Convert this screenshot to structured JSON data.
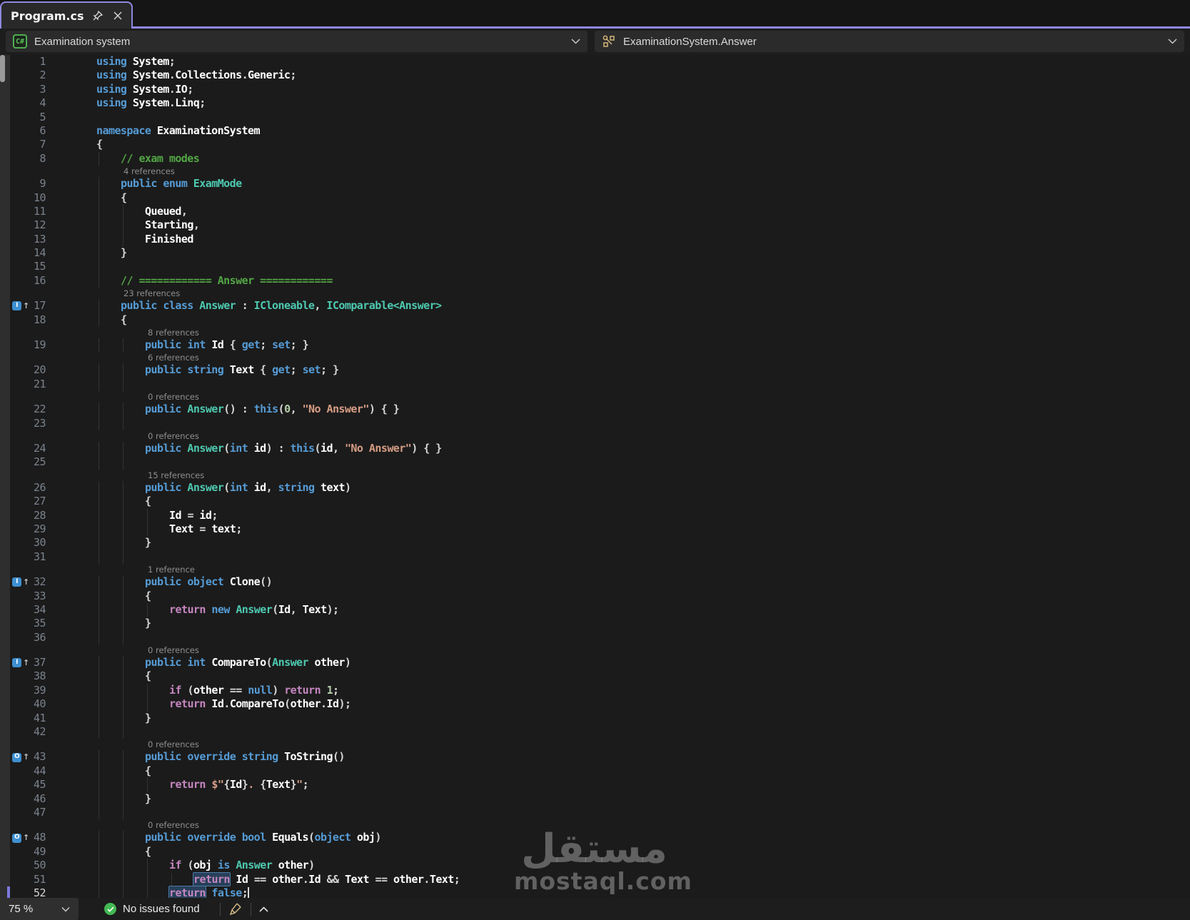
{
  "tab": {
    "title": "Program.cs"
  },
  "breadcrumb": {
    "project": "Examination system",
    "project_badge": "C#",
    "symbol": "ExaminationSystem.Answer"
  },
  "status": {
    "zoom": "75 %",
    "message": "No issues found"
  },
  "watermark": {
    "arabic": "مستقل",
    "domain": "mostaql.com"
  },
  "colors": {
    "accent_purple": "#8d88e0",
    "keyword": "#569cd6",
    "control_keyword": "#c586c0",
    "type": "#4ec9b0",
    "string": "#d69d85",
    "number": "#b5cea8",
    "comment": "#53a645",
    "ok_green": "#43b954",
    "badge_blue": "#3e8fd0"
  },
  "editor": {
    "rows": [
      {
        "t": "c",
        "n": 1,
        "i": 0,
        "k": [
          [
            "k",
            "using "
          ],
          [
            "i",
            "System"
          ],
          [
            "p",
            ";"
          ]
        ]
      },
      {
        "t": "c",
        "n": 2,
        "i": 0,
        "k": [
          [
            "k",
            "using "
          ],
          [
            "i",
            "System"
          ],
          [
            "p",
            "."
          ],
          [
            "i",
            "Collections"
          ],
          [
            "p",
            "."
          ],
          [
            "i",
            "Generic"
          ],
          [
            "p",
            ";"
          ]
        ]
      },
      {
        "t": "c",
        "n": 3,
        "i": 0,
        "k": [
          [
            "k",
            "using "
          ],
          [
            "i",
            "System"
          ],
          [
            "p",
            "."
          ],
          [
            "i",
            "IO"
          ],
          [
            "p",
            ";"
          ]
        ]
      },
      {
        "t": "c",
        "n": 4,
        "i": 0,
        "k": [
          [
            "k",
            "using "
          ],
          [
            "i",
            "System"
          ],
          [
            "p",
            "."
          ],
          [
            "i",
            "Linq"
          ],
          [
            "p",
            ";"
          ]
        ]
      },
      {
        "t": "c",
        "n": 5,
        "i": 0,
        "k": []
      },
      {
        "t": "c",
        "n": 6,
        "i": 0,
        "k": [
          [
            "k",
            "namespace "
          ],
          [
            "i",
            "ExaminationSystem"
          ]
        ]
      },
      {
        "t": "c",
        "n": 7,
        "i": 0,
        "k": [
          [
            "p",
            "{"
          ]
        ]
      },
      {
        "t": "c",
        "n": 8,
        "i": 1,
        "k": [
          [
            "m",
            "// exam modes"
          ]
        ]
      },
      {
        "t": "l",
        "i": 1,
        "s": "4 references"
      },
      {
        "t": "c",
        "n": 9,
        "i": 1,
        "k": [
          [
            "k",
            "public "
          ],
          [
            "k",
            "enum "
          ],
          [
            "t",
            "ExamMode"
          ]
        ]
      },
      {
        "t": "c",
        "n": 10,
        "i": 1,
        "k": [
          [
            "p",
            "{"
          ]
        ]
      },
      {
        "t": "c",
        "n": 11,
        "i": 2,
        "k": [
          [
            "i",
            "Queued"
          ],
          [
            "p",
            ","
          ]
        ]
      },
      {
        "t": "c",
        "n": 12,
        "i": 2,
        "k": [
          [
            "i",
            "Starting"
          ],
          [
            "p",
            ","
          ]
        ]
      },
      {
        "t": "c",
        "n": 13,
        "i": 2,
        "k": [
          [
            "i",
            "Finished"
          ]
        ]
      },
      {
        "t": "c",
        "n": 14,
        "i": 1,
        "k": [
          [
            "p",
            "}"
          ]
        ]
      },
      {
        "t": "c",
        "n": 15,
        "i": 1,
        "k": []
      },
      {
        "t": "c",
        "n": 16,
        "i": 1,
        "k": [
          [
            "m",
            "// ============ Answer ============"
          ]
        ]
      },
      {
        "t": "l",
        "i": 1,
        "s": "23 references"
      },
      {
        "t": "c",
        "n": 17,
        "i": 1,
        "g": "box",
        "k": [
          [
            "k",
            "public "
          ],
          [
            "k",
            "class "
          ],
          [
            "t",
            "Answer"
          ],
          [
            "p",
            " : "
          ],
          [
            "t",
            "ICloneable"
          ],
          [
            "p",
            ", "
          ],
          [
            "t",
            "IComparable<Answer>"
          ]
        ]
      },
      {
        "t": "c",
        "n": 18,
        "i": 1,
        "k": [
          [
            "p",
            "{"
          ]
        ]
      },
      {
        "t": "l",
        "i": 2,
        "s": "8 references"
      },
      {
        "t": "c",
        "n": 19,
        "i": 2,
        "k": [
          [
            "k",
            "public "
          ],
          [
            "k",
            "int "
          ],
          [
            "i",
            "Id"
          ],
          [
            "p",
            " { "
          ],
          [
            "k",
            "get"
          ],
          [
            "p",
            "; "
          ],
          [
            "k",
            "set"
          ],
          [
            "p",
            "; }"
          ]
        ]
      },
      {
        "t": "l",
        "i": 2,
        "s": "6 references"
      },
      {
        "t": "c",
        "n": 20,
        "i": 2,
        "k": [
          [
            "k",
            "public "
          ],
          [
            "k",
            "string "
          ],
          [
            "i",
            "Text"
          ],
          [
            "p",
            " { "
          ],
          [
            "k",
            "get"
          ],
          [
            "p",
            "; "
          ],
          [
            "k",
            "set"
          ],
          [
            "p",
            "; }"
          ]
        ]
      },
      {
        "t": "c",
        "n": 21,
        "i": 2,
        "k": []
      },
      {
        "t": "l",
        "i": 2,
        "s": "0 references"
      },
      {
        "t": "c",
        "n": 22,
        "i": 2,
        "k": [
          [
            "k",
            "public "
          ],
          [
            "t",
            "Answer"
          ],
          [
            "p",
            "() : "
          ],
          [
            "k",
            "this"
          ],
          [
            "p",
            "("
          ],
          [
            "n",
            "0"
          ],
          [
            "p",
            ", "
          ],
          [
            "s",
            "\"No Answer\""
          ],
          [
            "p",
            ") { }"
          ]
        ]
      },
      {
        "t": "c",
        "n": 23,
        "i": 2,
        "k": []
      },
      {
        "t": "l",
        "i": 2,
        "s": "0 references"
      },
      {
        "t": "c",
        "n": 24,
        "i": 2,
        "k": [
          [
            "k",
            "public "
          ],
          [
            "t",
            "Answer"
          ],
          [
            "p",
            "("
          ],
          [
            "k",
            "int "
          ],
          [
            "i",
            "id"
          ],
          [
            "p",
            ") : "
          ],
          [
            "k",
            "this"
          ],
          [
            "p",
            "("
          ],
          [
            "i",
            "id"
          ],
          [
            "p",
            ", "
          ],
          [
            "s",
            "\"No Answer\""
          ],
          [
            "p",
            ") { }"
          ]
        ]
      },
      {
        "t": "c",
        "n": 25,
        "i": 2,
        "k": []
      },
      {
        "t": "l",
        "i": 2,
        "s": "15 references"
      },
      {
        "t": "c",
        "n": 26,
        "i": 2,
        "k": [
          [
            "k",
            "public "
          ],
          [
            "t",
            "Answer"
          ],
          [
            "p",
            "("
          ],
          [
            "k",
            "int "
          ],
          [
            "i",
            "id"
          ],
          [
            "p",
            ", "
          ],
          [
            "k",
            "string "
          ],
          [
            "i",
            "text"
          ],
          [
            "p",
            ")"
          ]
        ]
      },
      {
        "t": "c",
        "n": 27,
        "i": 2,
        "k": [
          [
            "p",
            "{"
          ]
        ]
      },
      {
        "t": "c",
        "n": 28,
        "i": 3,
        "k": [
          [
            "i",
            "Id"
          ],
          [
            "p",
            " = "
          ],
          [
            "i",
            "id"
          ],
          [
            "p",
            ";"
          ]
        ]
      },
      {
        "t": "c",
        "n": 29,
        "i": 3,
        "k": [
          [
            "i",
            "Text"
          ],
          [
            "p",
            " = "
          ],
          [
            "i",
            "text"
          ],
          [
            "p",
            ";"
          ]
        ]
      },
      {
        "t": "c",
        "n": 30,
        "i": 2,
        "k": [
          [
            "p",
            "}"
          ]
        ]
      },
      {
        "t": "c",
        "n": 31,
        "i": 2,
        "k": []
      },
      {
        "t": "l",
        "i": 2,
        "s": "1 reference"
      },
      {
        "t": "c",
        "n": 32,
        "i": 2,
        "g": "box",
        "k": [
          [
            "k",
            "public "
          ],
          [
            "k",
            "object "
          ],
          [
            "f",
            "Clone"
          ],
          [
            "p",
            "()"
          ]
        ]
      },
      {
        "t": "c",
        "n": 33,
        "i": 2,
        "k": [
          [
            "p",
            "{"
          ]
        ]
      },
      {
        "t": "c",
        "n": 34,
        "i": 3,
        "k": [
          [
            "c",
            "return "
          ],
          [
            "k",
            "new "
          ],
          [
            "t",
            "Answer"
          ],
          [
            "p",
            "("
          ],
          [
            "i",
            "Id"
          ],
          [
            "p",
            ", "
          ],
          [
            "i",
            "Text"
          ],
          [
            "p",
            ");"
          ]
        ]
      },
      {
        "t": "c",
        "n": 35,
        "i": 2,
        "k": [
          [
            "p",
            "}"
          ]
        ]
      },
      {
        "t": "c",
        "n": 36,
        "i": 2,
        "k": []
      },
      {
        "t": "l",
        "i": 2,
        "s": "0 references"
      },
      {
        "t": "c",
        "n": 37,
        "i": 2,
        "g": "box",
        "k": [
          [
            "k",
            "public "
          ],
          [
            "k",
            "int "
          ],
          [
            "f",
            "CompareTo"
          ],
          [
            "p",
            "("
          ],
          [
            "t",
            "Answer"
          ],
          [
            "i",
            " other"
          ],
          [
            "p",
            ")"
          ]
        ]
      },
      {
        "t": "c",
        "n": 38,
        "i": 2,
        "k": [
          [
            "p",
            "{"
          ]
        ]
      },
      {
        "t": "c",
        "n": 39,
        "i": 3,
        "k": [
          [
            "c",
            "if"
          ],
          [
            "p",
            " ("
          ],
          [
            "i",
            "other"
          ],
          [
            "p",
            " == "
          ],
          [
            "k",
            "null"
          ],
          [
            "p",
            ") "
          ],
          [
            "c",
            "return "
          ],
          [
            "n",
            "1"
          ],
          [
            "p",
            ";"
          ]
        ]
      },
      {
        "t": "c",
        "n": 40,
        "i": 3,
        "k": [
          [
            "c",
            "return "
          ],
          [
            "i",
            "Id"
          ],
          [
            "p",
            "."
          ],
          [
            "f",
            "CompareTo"
          ],
          [
            "p",
            "("
          ],
          [
            "i",
            "other"
          ],
          [
            "p",
            "."
          ],
          [
            "i",
            "Id"
          ],
          [
            "p",
            ");"
          ]
        ]
      },
      {
        "t": "c",
        "n": 41,
        "i": 2,
        "k": [
          [
            "p",
            "}"
          ]
        ]
      },
      {
        "t": "c",
        "n": 42,
        "i": 2,
        "k": []
      },
      {
        "t": "l",
        "i": 2,
        "s": "0 references"
      },
      {
        "t": "c",
        "n": 43,
        "i": 2,
        "g": "circle",
        "k": [
          [
            "k",
            "public "
          ],
          [
            "k",
            "override "
          ],
          [
            "k",
            "string "
          ],
          [
            "f",
            "ToString"
          ],
          [
            "p",
            "()"
          ]
        ]
      },
      {
        "t": "c",
        "n": 44,
        "i": 2,
        "k": [
          [
            "p",
            "{"
          ]
        ]
      },
      {
        "t": "c",
        "n": 45,
        "i": 3,
        "k": [
          [
            "c",
            "return "
          ],
          [
            "s",
            "$\""
          ],
          [
            "p",
            "{"
          ],
          [
            "i",
            "Id"
          ],
          [
            "p",
            "}"
          ],
          [
            "s",
            ". "
          ],
          [
            "p",
            "{"
          ],
          [
            "i",
            "Text"
          ],
          [
            "p",
            "}"
          ],
          [
            "s",
            "\""
          ],
          [
            "p",
            ";"
          ]
        ]
      },
      {
        "t": "c",
        "n": 46,
        "i": 2,
        "k": [
          [
            "p",
            "}"
          ]
        ]
      },
      {
        "t": "c",
        "n": 47,
        "i": 2,
        "k": []
      },
      {
        "t": "l",
        "i": 2,
        "s": "0 references"
      },
      {
        "t": "c",
        "n": 48,
        "i": 2,
        "g": "circle",
        "k": [
          [
            "k",
            "public "
          ],
          [
            "k",
            "override "
          ],
          [
            "k",
            "bool "
          ],
          [
            "f",
            "Equals"
          ],
          [
            "p",
            "("
          ],
          [
            "k",
            "object "
          ],
          [
            "i",
            "obj"
          ],
          [
            "p",
            ")"
          ]
        ]
      },
      {
        "t": "c",
        "n": 49,
        "i": 2,
        "k": [
          [
            "p",
            "{"
          ]
        ]
      },
      {
        "t": "c",
        "n": 50,
        "i": 3,
        "k": [
          [
            "c",
            "if"
          ],
          [
            "p",
            " ("
          ],
          [
            "i",
            "obj"
          ],
          [
            "p",
            " "
          ],
          [
            "k",
            "is"
          ],
          [
            "p",
            " "
          ],
          [
            "t",
            "Answer"
          ],
          [
            "i",
            " other"
          ],
          [
            "p",
            ")"
          ]
        ]
      },
      {
        "t": "c",
        "n": 51,
        "i": 4,
        "k": [
          [
            "c",
            "return",
            "hl"
          ],
          [
            "p",
            " "
          ],
          [
            "i",
            "Id"
          ],
          [
            "p",
            " == "
          ],
          [
            "i",
            "other"
          ],
          [
            "p",
            "."
          ],
          [
            "i",
            "Id"
          ],
          [
            "p",
            " && "
          ],
          [
            "i",
            "Text"
          ],
          [
            "p",
            " == "
          ],
          [
            "i",
            "other"
          ],
          [
            "p",
            "."
          ],
          [
            "i",
            "Text"
          ],
          [
            "p",
            ";"
          ]
        ]
      },
      {
        "t": "c",
        "n": 52,
        "i": 3,
        "cur": true,
        "caret": true,
        "cursor": true,
        "k": [
          [
            "c",
            "return",
            "hl"
          ],
          [
            "p",
            " "
          ],
          [
            "k",
            "false"
          ],
          [
            "p",
            ";"
          ]
        ]
      }
    ]
  }
}
